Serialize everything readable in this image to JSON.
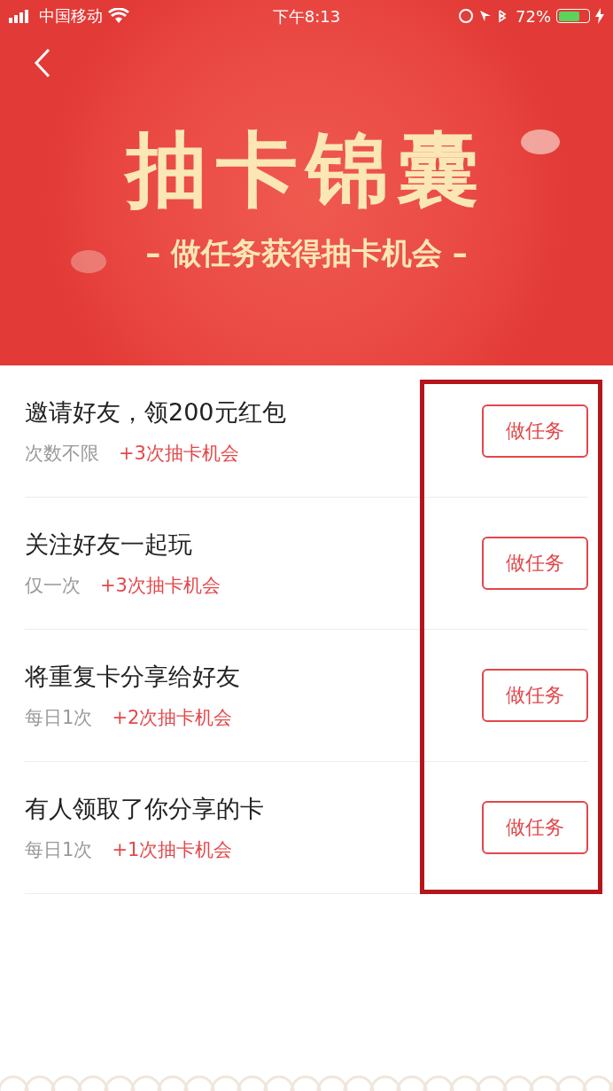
{
  "status_bar": {
    "carrier": "中国移动",
    "time": "下午8:13",
    "battery": "72%"
  },
  "banner": {
    "title": "抽卡锦囊",
    "subtitle": "– 做任务获得抽卡机会 –"
  },
  "tasks": [
    {
      "title": "邀请好友，领200元红包",
      "limit": "次数不限",
      "reward": "+3次抽卡机会",
      "button": "做任务"
    },
    {
      "title": "关注好友一起玩",
      "limit": "仅一次",
      "reward": "+3次抽卡机会",
      "button": "做任务"
    },
    {
      "title": "将重复卡分享给好友",
      "limit": "每日1次",
      "reward": "+2次抽卡机会",
      "button": "做任务"
    },
    {
      "title": "有人领取了你分享的卡",
      "limit": "每日1次",
      "reward": "+1次抽卡机会",
      "button": "做任务"
    }
  ],
  "highlight": true
}
